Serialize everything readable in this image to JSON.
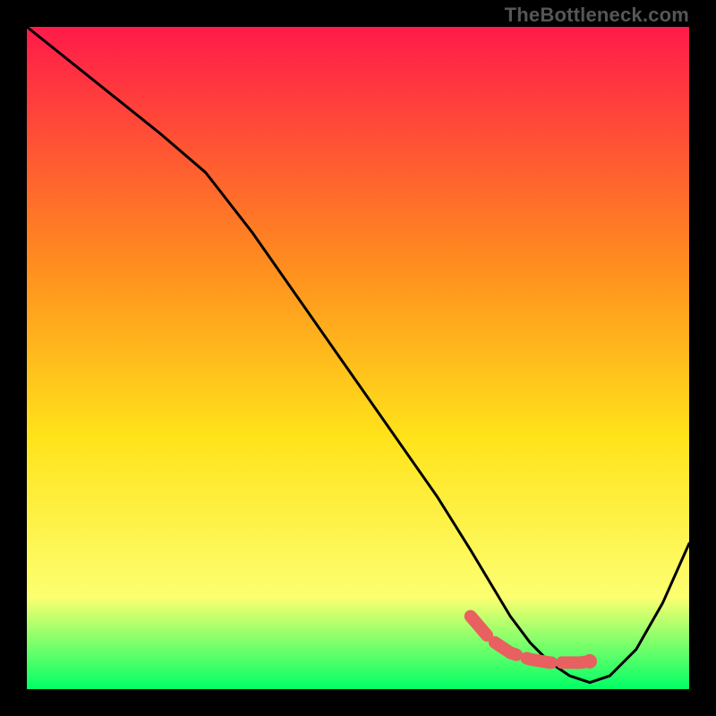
{
  "watermark": "TheBottleneck.com",
  "colors": {
    "background": "#000000",
    "gradient_top": "#ff1a4a",
    "gradient_mid1": "#ff8a1f",
    "gradient_mid2": "#ffe31a",
    "gradient_mid3": "#fdff70",
    "gradient_bottom": "#00ff66",
    "curve": "#000000",
    "marker": "#e86060"
  },
  "chart_data": {
    "type": "line",
    "title": "",
    "xlabel": "",
    "ylabel": "",
    "xlim": [
      0,
      100
    ],
    "ylim": [
      0,
      100
    ],
    "grid": false,
    "legend": false,
    "series": [
      {
        "name": "bottleneck-curve",
        "x": [
          0,
          10,
          20,
          27,
          34,
          41,
          48,
          55,
          62,
          67,
          70,
          73,
          76,
          79,
          82,
          85,
          88,
          92,
          96,
          100
        ],
        "y": [
          100,
          92,
          84,
          78,
          69,
          59,
          49,
          39,
          29,
          21,
          16,
          11,
          7,
          4,
          2,
          1,
          2,
          6,
          13,
          22
        ]
      }
    ],
    "markers": {
      "name": "highlight-segment",
      "x": [
        67,
        70,
        73,
        76,
        79,
        82,
        83.5,
        85
      ],
      "y": [
        11,
        7.5,
        5.5,
        4.5,
        4,
        4,
        4,
        4.2
      ]
    },
    "marker_dot": {
      "x": 85,
      "y": 4.2
    }
  }
}
